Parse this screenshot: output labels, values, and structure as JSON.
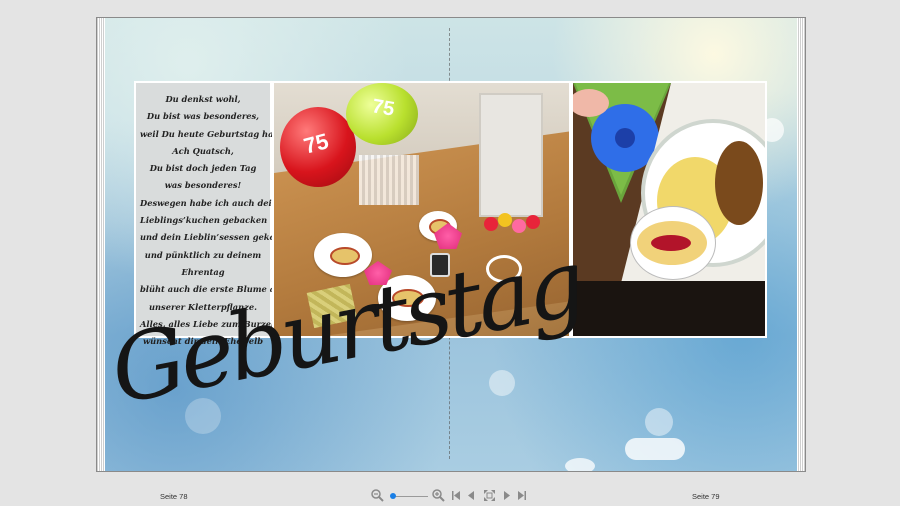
{
  "book": {
    "title_script": "Geburtstag",
    "poem": [
      "Du denkst wohl,",
      "Du bist was besonderes,",
      "weil Du heute Geburtstag hast?",
      "Ach Quatsch,",
      "Du bist doch jeden Tag",
      "was besonderes!",
      "Deswegen habe ich auch deinen",
      "Lieblings’kuchen gebacken",
      "und dein Lieblin’sessen gekocht",
      "und pünktlich zu deinem",
      "Ehrentag",
      "blüht auch die erste Blume an",
      "unserer Kletterpflanze.",
      "Alles, alles Liebe zum Burzeltag",
      "wünscht dir dein Ehewelb"
    ],
    "balloon_numbers": [
      "75",
      "75"
    ]
  },
  "viewer": {
    "page_left": "Seite 78",
    "page_right": "Seite 79",
    "zoom_level": 0.05
  },
  "icons": {
    "zoom_out": "zoom-out-icon",
    "zoom_in": "zoom-in-icon",
    "first": "first-page-icon",
    "prev": "previous-page-icon",
    "fit": "fit-to-window-icon",
    "next": "next-page-icon",
    "last": "last-page-icon"
  },
  "colors": {
    "accent": "#1a7fe6",
    "balloon_red": "#d8141c",
    "balloon_green": "#b9e02e",
    "flower_blue": "#2f6ee8"
  }
}
